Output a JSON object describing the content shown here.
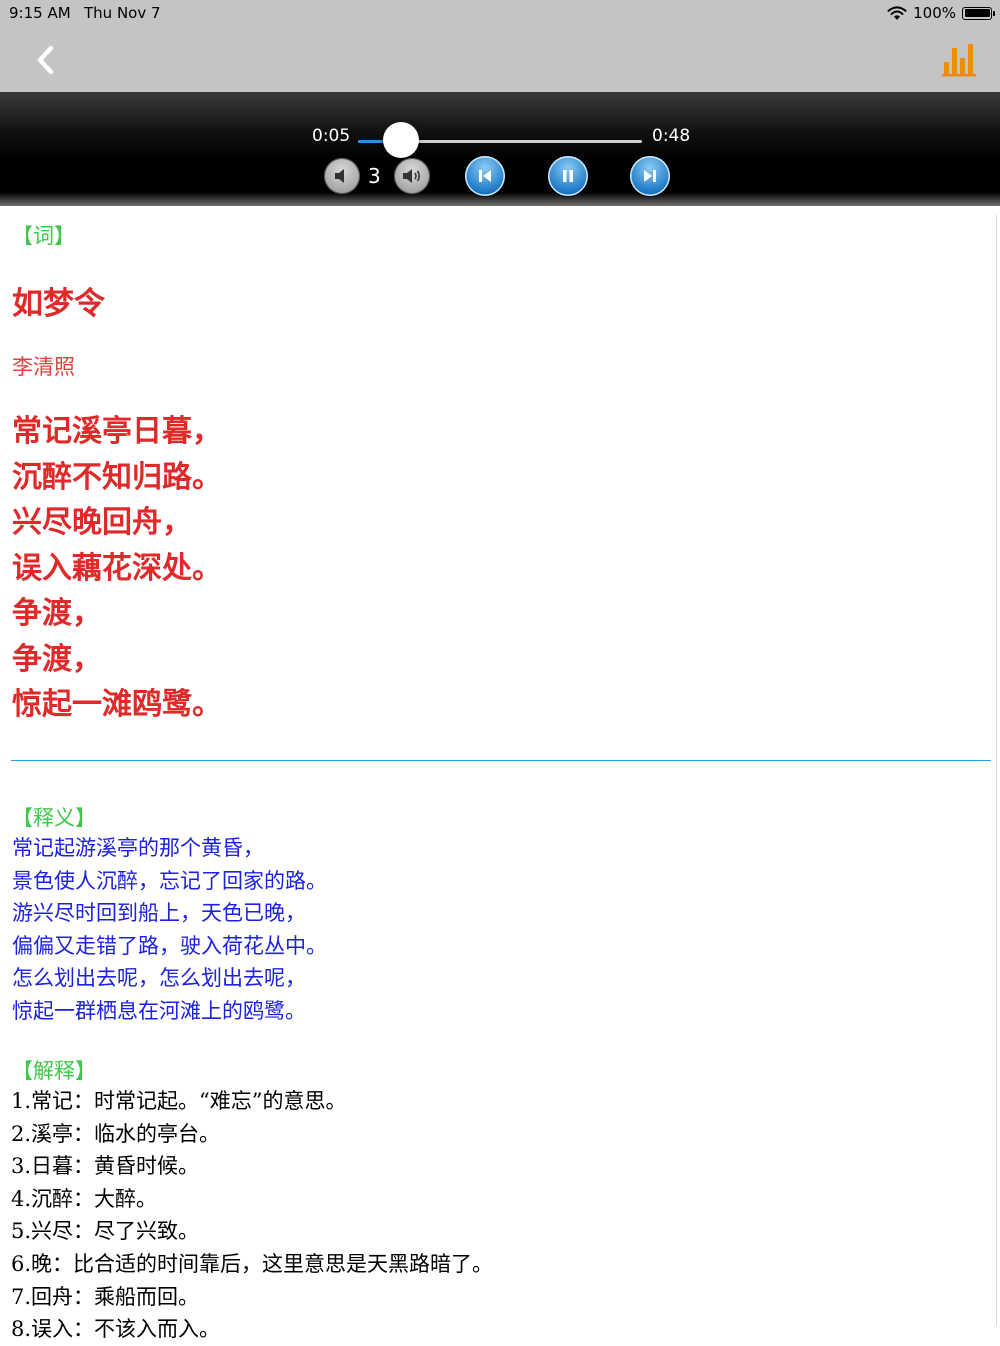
{
  "status_bar": {
    "time": "9:15 AM",
    "date": "Thu Nov 7",
    "battery": "100%"
  },
  "nav": {
    "back_icon": "chevron-left-icon",
    "right_icon": "bar-chart-icon",
    "right_icon_color": "#f08a12"
  },
  "player": {
    "current_time": "0:05",
    "total_time": "0:48",
    "progress_fraction": 0.15,
    "volume": "3",
    "accent_color": "#2b8fe0"
  },
  "poem": {
    "section_label": "【词】",
    "title": "如梦令",
    "author": "李清照",
    "lines": [
      "常记溪亭日暮，",
      "沉醉不知归路。",
      "兴尽晚回舟，",
      "误入藕花深处。",
      "争渡，",
      "争渡，",
      "惊起一滩鸥鹭。"
    ],
    "color": "#e02a2a"
  },
  "translation": {
    "section_label": "【释义】",
    "lines": [
      "常记起游溪亭的那个黄昏，",
      "景色使人沉醉，忘记了回家的路。",
      "游兴尽时回到船上，天色已晚，",
      "偏偏又走错了路，驶入荷花丛中。",
      "怎么划出去呢，怎么划出去呢，",
      "惊起一群栖息在河滩上的鸥鹭。"
    ],
    "color": "#1d22e0"
  },
  "notes": {
    "section_label": "【解释】",
    "lines": [
      "1.常记：时常记起。“难忘”的意思。",
      "2.溪亭：临水的亭台。",
      "3.日暮：黄昏时候。",
      "4.沉醉：大醉。",
      "5.兴尽：尽了兴致。",
      "6.晚：比合适的时间靠后，这里意思是天黑路暗了。",
      "7.回舟：乘船而回。",
      "8.误入：不该入而入。"
    ]
  },
  "section_label_color": "#3ec84a"
}
